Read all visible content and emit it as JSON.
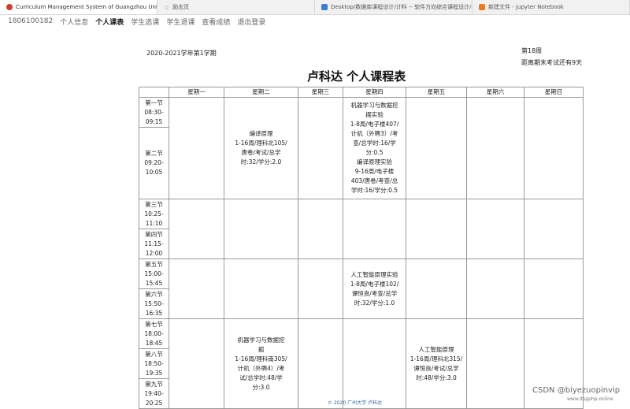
{
  "browser": {
    "tabs": [
      {
        "label": "Curriculum Management System of Guangzhou University",
        "icon": "university-icon"
      },
      {
        "label": "励志页",
        "icon": "star-icon"
      },
      {
        "label": "Desktop/数据库课程设计/计科 -- 软件方向综合课程设计/",
        "icon": "folder-icon"
      },
      {
        "label": "新建文件 - Jupyter Notebook",
        "icon": "jupyter-icon"
      }
    ]
  },
  "nav": {
    "student_id": "1806100182",
    "items": [
      "个人信息",
      "个人课表",
      "学生选课",
      "学生退课",
      "查看成绩",
      "退出登录"
    ]
  },
  "schedule": {
    "term": "2020-2021学年第1学期",
    "week": "第18周",
    "countdown": "距离期末考试还有9天",
    "title": "卢科达 个人课程表",
    "days": [
      "星期一",
      "星期二",
      "星期三",
      "星期四",
      "星期五",
      "星期六",
      "星期日"
    ],
    "periods": [
      [
        "第一节",
        "08:30-",
        "09:15"
      ],
      [
        "第二节",
        "09:20-",
        "10:05"
      ],
      [
        "第三节",
        "10:25-",
        "11:10"
      ],
      [
        "第四节",
        "11:15-",
        "12:00"
      ],
      [
        "第五节",
        "15:00-",
        "15:45"
      ],
      [
        "第六节",
        "15:50-",
        "16:35"
      ],
      [
        "第七节",
        "18:00-",
        "18:45"
      ],
      [
        "第八节",
        "18:50-",
        "19:35"
      ],
      [
        "第九节",
        "19:40-",
        "20:25"
      ]
    ],
    "courses": {
      "tue_1_2": [
        "编译原理",
        "1-16周/理科北105/",
        "唐卷/考试/总学",
        "时:32/学分:2.0"
      ],
      "thu_1_2": [
        "机器学习与数据挖",
        "掘实验",
        "1-8周/电子楼407/",
        "计机（外聘3）/考",
        "查/总学时:16/学",
        "分:0.5",
        "编译原理实验",
        "9-16周/电子楼",
        "403/唐卷/考查/总",
        "学时:16/学分:0.5"
      ],
      "thu_5_6": [
        "人工智能原理实验",
        "1-8周/电子楼102/",
        "谭恒良/考查/总学",
        "时:32/学分:1.0"
      ],
      "tue_7_9": [
        "机器学习与数据挖",
        "掘",
        "1-16周/理科南305/",
        "计机（外聘4）/考",
        "试/总学时:48/学",
        "分:3.0"
      ],
      "fri_7_9": [
        "人工智能原理",
        "1-16周/理科北315/",
        "谭恒良/考试/总学",
        "时:48/学分:3.0"
      ]
    }
  },
  "footer": {
    "text": "© 2020 广州大学 卢科达",
    "watermark": "CSDN @biyezuopinvip",
    "watermark_url": "www.itspphp.online"
  }
}
